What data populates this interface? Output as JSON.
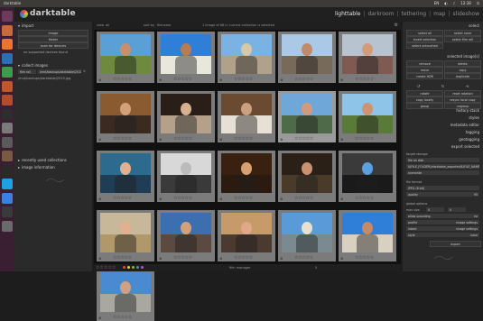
{
  "system_bar": {
    "title": "darktable",
    "indicators": [
      "EN",
      "◐",
      "♪",
      "12:38",
      "⏻"
    ]
  },
  "launcher": {
    "items": [
      {
        "name": "dash",
        "color": "#6d3a5d"
      },
      {
        "name": "files",
        "color": "#c86b3a"
      },
      {
        "name": "firefox",
        "color": "#e8762e"
      },
      {
        "name": "libreoffice-writer",
        "color": "#2b6fb5"
      },
      {
        "name": "libreoffice-calc",
        "color": "#3e9b4c"
      },
      {
        "name": "libreoffice-impress",
        "color": "#c2572a"
      },
      {
        "name": "software-center",
        "color": "#b14d2d"
      },
      {
        "name": "terminal",
        "color": "#2d2d2d"
      },
      {
        "name": "settings",
        "color": "#7a7a7a"
      },
      {
        "name": "darktable",
        "color": "#5a5a5a"
      },
      {
        "name": "gimp",
        "color": "#7a5a40"
      },
      {
        "name": "inkscape",
        "color": "#2a2a2a"
      },
      {
        "name": "skype",
        "color": "#1da1e0"
      },
      {
        "name": "chrome",
        "color": "#3b7fe2"
      },
      {
        "name": "network",
        "color": "#3a3a3a"
      },
      {
        "name": "trash",
        "color": "#6a6a6a"
      }
    ]
  },
  "app": {
    "logo_text": "darktable",
    "views": [
      "lighttable",
      "darkroom",
      "tethering",
      "map",
      "slideshow"
    ],
    "active_view": "lighttable"
  },
  "left": {
    "import": {
      "title": "import",
      "buttons": [
        "image",
        "folder",
        "scan for devices"
      ],
      "note": "no supported devices found"
    },
    "collect": {
      "title": "collect images",
      "filter_label": "film roll",
      "filter_value": "/mnt/backups/darktable/2015.jpg",
      "roll_path": "/mnt/backups/darktable/2015.jpg"
    },
    "recent": {
      "title": "recently used collections"
    },
    "info": {
      "title": "image information"
    }
  },
  "center": {
    "toolbar": {
      "view_label": "view",
      "view_value": "all",
      "sort_label": "sort by",
      "sort_value": "filename",
      "status": "1 image of 68 in current collection is selected"
    },
    "bottom": {
      "zoom_label": "film manager",
      "zoom_value": "5"
    },
    "color_labels": [
      "#e24b3b",
      "#f2d032",
      "#7bbf3f",
      "#3d8fd1",
      "#a05fc0"
    ]
  },
  "thumbnails": [
    {
      "sky": "#5aa0d6",
      "ground": "#6d8a3e",
      "skin": "#c98f6d"
    },
    {
      "sky": "#2f7fd8",
      "ground": "#e9e6dc",
      "skin": "#b97a56"
    },
    {
      "sky": "#7ab3e3",
      "ground": "#b0a28a",
      "skin": "#d8c8a8"
    },
    {
      "sky": "#a9c9e6",
      "ground": "#786a5a",
      "skin": "#c28a6a"
    },
    {
      "sky": "#b7c4cf",
      "ground": "#7e5a52",
      "skin": "#d39a7c"
    },
    {
      "sky": "#8a5a30",
      "ground": "#3a2a20",
      "skin": "#d4a07a"
    },
    {
      "sky": "#2a1e18",
      "ground": "#b5a08a",
      "skin": "#d8b090"
    },
    {
      "sky": "#6a4a30",
      "ground": "#e7e0d4",
      "skin": "#caa080"
    },
    {
      "sky": "#6fa8d8",
      "ground": "#4e6a48",
      "skin": "#d29a7c"
    },
    {
      "sky": "#8ec4e8",
      "ground": "#5a7a3a",
      "skin": "#cd9474"
    },
    {
      "sky": "#2c6a8e",
      "ground": "#1f3d55",
      "skin": "#e0b090"
    },
    {
      "sky": "#d8d8d8",
      "ground": "#3a3a3a",
      "skin": "#bbbbbb"
    },
    {
      "sky": "#3a2010",
      "ground": "#2a1a10",
      "skin": "#d8a070"
    },
    {
      "sky": "#2a2018",
      "ground": "#4a3a2a",
      "skin": "#c89270"
    },
    {
      "sky": "#3a3a3a",
      "ground": "#1a1a1a",
      "skin": "#5aa0e0"
    },
    {
      "sky": "#c8b89a",
      "ground": "#b0986a",
      "skin": "#e0b090"
    },
    {
      "sky": "#3b6fb0",
      "ground": "#5a4a40",
      "skin": "#d4a07c"
    },
    {
      "sky": "#c79a6a",
      "ground": "#4a3a30",
      "skin": "#e0a888"
    },
    {
      "sky": "#5a9ad8",
      "ground": "#7a8a90",
      "skin": "#e8e0d0"
    },
    {
      "sky": "#2f7fd8",
      "ground": "#d8d0c0",
      "skin": "#c48a6a"
    },
    {
      "sky": "#4a8ad0",
      "ground": "#a8a8a0",
      "skin": "#d0a080"
    }
  ],
  "right": {
    "select": {
      "title": "select",
      "buttons": [
        "select all",
        "select none",
        "invert selection",
        "select film roll",
        "select untouched"
      ]
    },
    "selected": {
      "title": "selected image[s]",
      "buttons": [
        "remove",
        "delete",
        "move",
        "copy",
        "create HDR",
        "duplicate",
        "rotate",
        "reset rotation",
        "copy locally",
        "resync local copy",
        "group",
        "ungroup"
      ]
    },
    "sections": [
      "history stack",
      "styles",
      "metadata editor",
      "tagging",
      "geotagging",
      "export selected"
    ],
    "export": {
      "target_label": "target storage",
      "target_value": "file on disk",
      "path": "$(FILE_FOLDER)/darktable_exported/$(FILE_NAME)",
      "on_conflict": "overwrite",
      "format_label": "file format",
      "format_value": "JPEG (8-bit)",
      "quality_label": "quality",
      "quality_value": "95",
      "global_label": "global options",
      "size_label": "max size",
      "size_w": "0",
      "size_h": "0",
      "upscale_label": "allow upscaling",
      "upscale_value": "no",
      "profile_label": "profile",
      "profile_value": "image settings",
      "intent_label": "intent",
      "intent_value": "image settings",
      "style_label": "style",
      "style_value": "none",
      "export_button": "export"
    }
  }
}
